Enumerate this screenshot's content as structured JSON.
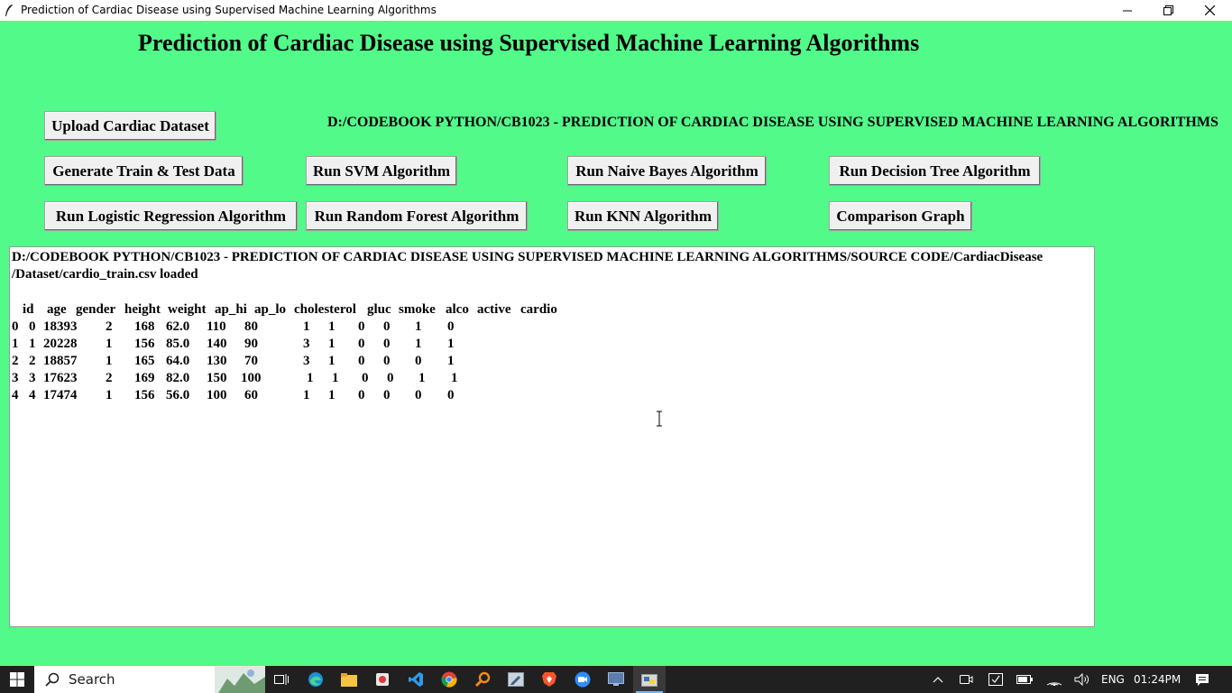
{
  "window": {
    "title": "Prediction of Cardiac Disease using Supervised Machine Learning Algorithms"
  },
  "header": {
    "title": "Prediction of Cardiac Disease using Supervised Machine Learning Algorithms",
    "path_label": "D:/CODEBOOK PYTHON/CB1023 - PREDICTION OF CARDIAC DISEASE USING SUPERVISED MACHINE LEARNING ALGORITHMS"
  },
  "buttons": {
    "upload": "Upload Cardiac Dataset",
    "generate": "Generate Train & Test Data",
    "svm": "Run SVM Algorithm",
    "naive_bayes": "Run Naive Bayes Algorithm",
    "decision_tree": "Run Decision Tree Algorithm",
    "logistic": "Run Logistic Regression Algorithm",
    "random_forest": "Run Random Forest Algorithm",
    "knn": "Run KNN Algorithm",
    "comparison": "Comparison Graph"
  },
  "output": {
    "line1": "D:/CODEBOOK PYTHON/CB1023 - PREDICTION OF CARDIAC DISEASE USING SUPERVISED MACHINE LEARNING ALGORITHMS/SOURCE CODE/CardiacDisease",
    "line2": "/Dataset/cardio_train.csv loaded",
    "table": {
      "columns": [
        "id",
        "age",
        "gender",
        "height",
        "weight",
        "ap_hi",
        "ap_lo",
        "cholesterol",
        "gluc",
        "smoke",
        "alco",
        "active",
        "cardio"
      ],
      "rows": [
        [
          "0",
          "0",
          "18393",
          "2",
          "168",
          "62.0",
          "110",
          "80",
          "1",
          "1",
          "0",
          "0",
          "1",
          "0"
        ],
        [
          "1",
          "1",
          "20228",
          "1",
          "156",
          "85.0",
          "140",
          "90",
          "3",
          "1",
          "0",
          "0",
          "1",
          "1"
        ],
        [
          "2",
          "2",
          "18857",
          "1",
          "165",
          "64.0",
          "130",
          "70",
          "3",
          "1",
          "0",
          "0",
          "0",
          "1"
        ],
        [
          "3",
          "3",
          "17623",
          "2",
          "169",
          "82.0",
          "150",
          "100",
          "1",
          "1",
          "0",
          "0",
          "1",
          "1"
        ],
        [
          "4",
          "4",
          "17474",
          "1",
          "156",
          "56.0",
          "100",
          "60",
          "1",
          "1",
          "0",
          "0",
          "0",
          "0"
        ]
      ]
    }
  },
  "taskbar": {
    "search_placeholder": "Search",
    "language": "ENG",
    "time": "01:24PM"
  },
  "colors": {
    "background": "#52fa89",
    "taskbar": "#202020"
  }
}
